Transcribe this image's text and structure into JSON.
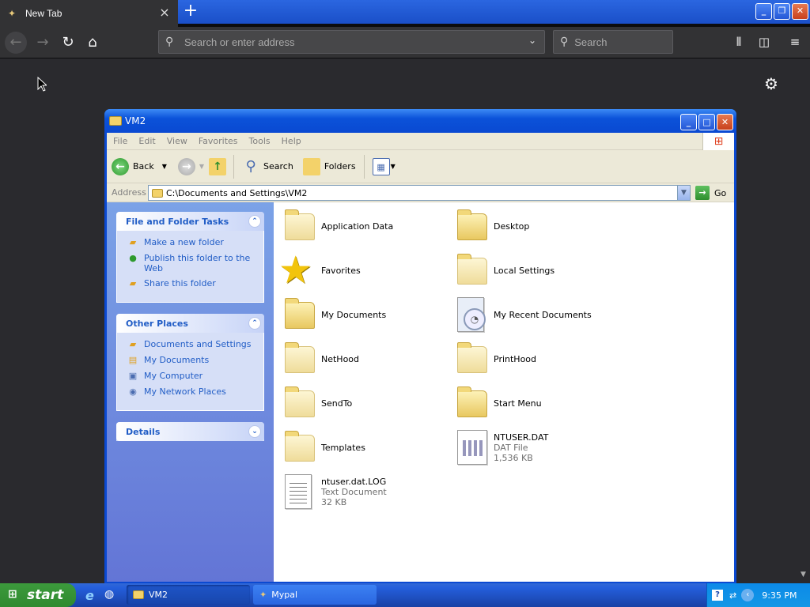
{
  "browser": {
    "tab_title": "New Tab",
    "url_placeholder": "Search or enter address",
    "search_placeholder": "Search"
  },
  "explorer": {
    "window_title": "VM2",
    "menu": [
      "File",
      "Edit",
      "View",
      "Favorites",
      "Tools",
      "Help"
    ],
    "toolbar": {
      "back": "Back",
      "search": "Search",
      "folders": "Folders"
    },
    "address_label": "Address",
    "address_value": "C:\\Documents and Settings\\VM2",
    "go_label": "Go",
    "tasks": {
      "file_folder_title": "File and Folder Tasks",
      "file_folder_items": [
        "Make a new folder",
        "Publish this folder to the Web",
        "Share this folder"
      ],
      "other_places_title": "Other Places",
      "other_places_items": [
        "Documents and Settings",
        "My Documents",
        "My Computer",
        "My Network Places"
      ],
      "details_title": "Details"
    },
    "files": [
      {
        "name": "Application Data",
        "type": "folder-faded"
      },
      {
        "name": "Desktop",
        "type": "folder"
      },
      {
        "name": "Favorites",
        "type": "star"
      },
      {
        "name": "Local Settings",
        "type": "folder-faded"
      },
      {
        "name": "My Documents",
        "type": "folder"
      },
      {
        "name": "My Recent Documents",
        "type": "recent"
      },
      {
        "name": "NetHood",
        "type": "folder-faded"
      },
      {
        "name": "PrintHood",
        "type": "folder-faded"
      },
      {
        "name": "SendTo",
        "type": "folder-faded"
      },
      {
        "name": "Start Menu",
        "type": "folder"
      },
      {
        "name": "Templates",
        "type": "folder-faded"
      },
      {
        "name": "NTUSER.DAT",
        "type": "dat",
        "sub1": "DAT File",
        "sub2": "1,536 KB"
      },
      {
        "name": "ntuser.dat.LOG",
        "type": "text",
        "sub1": "Text Document",
        "sub2": "32 KB"
      }
    ]
  },
  "taskbar": {
    "start_label": "start",
    "tasks": [
      "VM2",
      "Mypal"
    ],
    "clock": "9:35 PM"
  }
}
